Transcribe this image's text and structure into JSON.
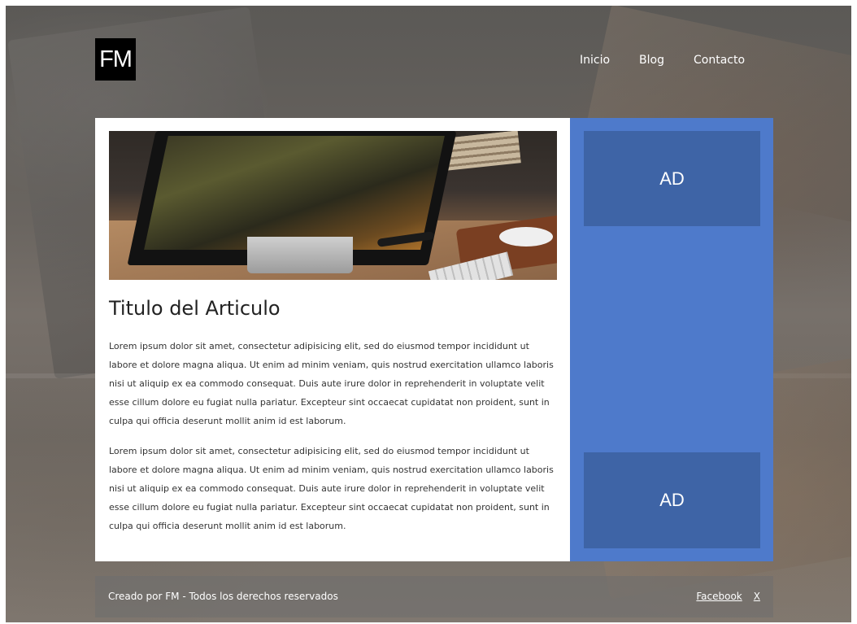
{
  "header": {
    "logo": "FM",
    "nav": [
      {
        "label": "Inicio"
      },
      {
        "label": "Blog"
      },
      {
        "label": "Contacto"
      }
    ]
  },
  "article": {
    "title": "Titulo del Articulo",
    "paragraphs": [
      "Lorem ipsum dolor sit amet, consectetur adipisicing elit, sed do eiusmod tempor incididunt ut labore et dolore magna aliqua. Ut enim ad minim veniam, quis nostrud exercitation ullamco laboris nisi ut aliquip ex ea commodo consequat. Duis aute irure dolor in reprehenderit in voluptate velit esse cillum dolore eu fugiat nulla pariatur. Excepteur sint occaecat cupidatat non proident, sunt in culpa qui officia deserunt mollit anim id est laborum.",
      "Lorem ipsum dolor sit amet, consectetur adipisicing elit, sed do eiusmod tempor incididunt ut labore et dolore magna aliqua. Ut enim ad minim veniam, quis nostrud exercitation ullamco laboris nisi ut aliquip ex ea commodo consequat. Duis aute irure dolor in reprehenderit in voluptate velit esse cillum dolore eu fugiat nulla pariatur. Excepteur sint occaecat cupidatat non proident, sunt in culpa qui officia deserunt mollit anim id est laborum."
    ]
  },
  "sidebar": {
    "ads": [
      {
        "label": "AD"
      },
      {
        "label": "AD"
      }
    ]
  },
  "footer": {
    "copyright": "Creado por FM - Todos los derechos reservados",
    "links": [
      {
        "label": "Facebook"
      },
      {
        "label": "X"
      }
    ]
  },
  "colors": {
    "sidebar": "#4e7acb",
    "ad_box": "#3e64a6",
    "card": "#ffffff",
    "logo_bg": "#000000"
  }
}
